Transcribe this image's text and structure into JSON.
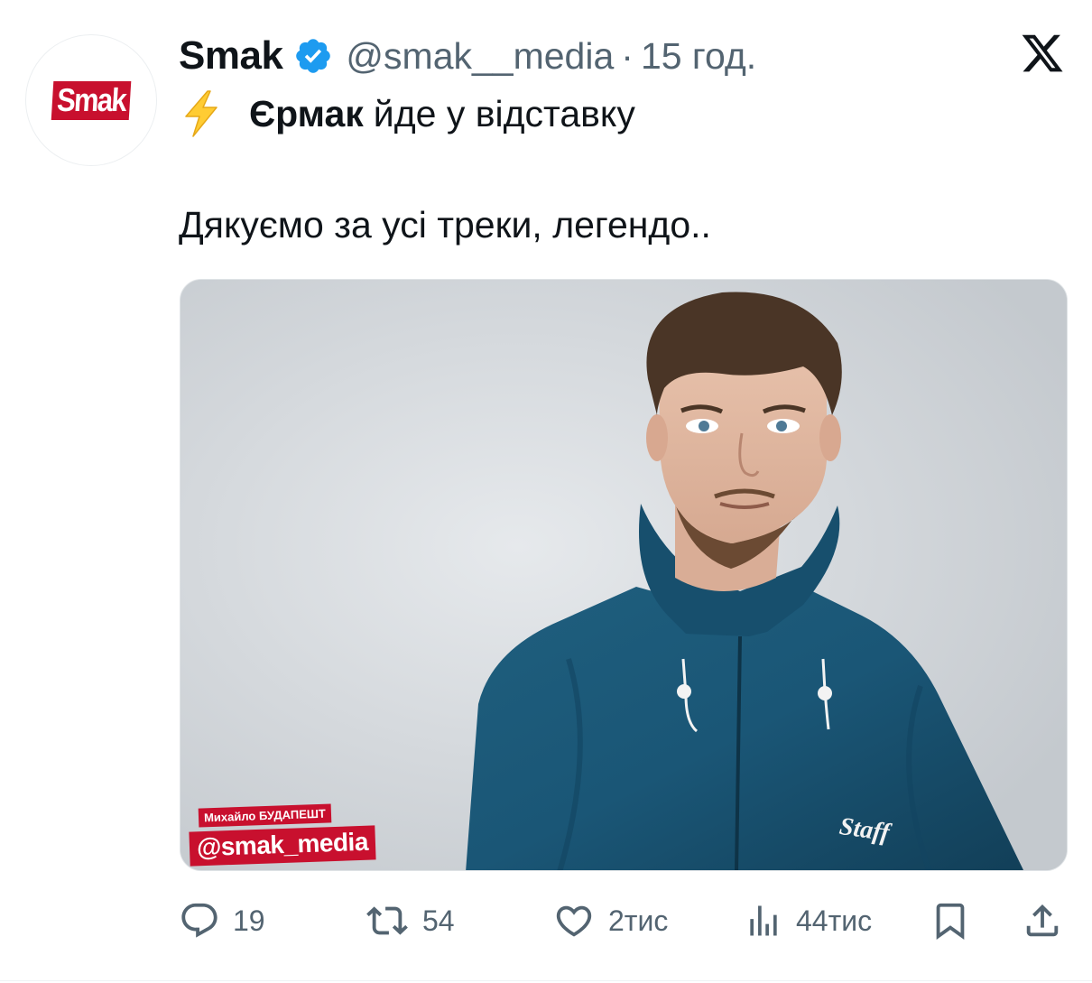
{
  "tweet": {
    "author": {
      "display_name": "Smak",
      "handle": "@smak__media",
      "avatar_logo_text": "Smak",
      "verified": true
    },
    "separator": "·",
    "time": "15 год.",
    "lead_emoji": "lightning-bolt-icon",
    "line1_bold": "Єрмак",
    "line1_rest": "йде у відставку",
    "line2": "Дякуємо за усі треки, легендо..",
    "media": {
      "overlay_credit": "Михайло БУДАПЕШТ",
      "overlay_handle": "@smak_media",
      "jacket_logo_text": "Staff"
    }
  },
  "actions": {
    "replies": "19",
    "retweets": "54",
    "likes": "2тис",
    "views": "44тис"
  },
  "colors": {
    "accent_red": "#c8102e",
    "verified_blue": "#1d9bf0",
    "muted_text": "#536471",
    "lightning_yellow": "#ffcc33"
  }
}
